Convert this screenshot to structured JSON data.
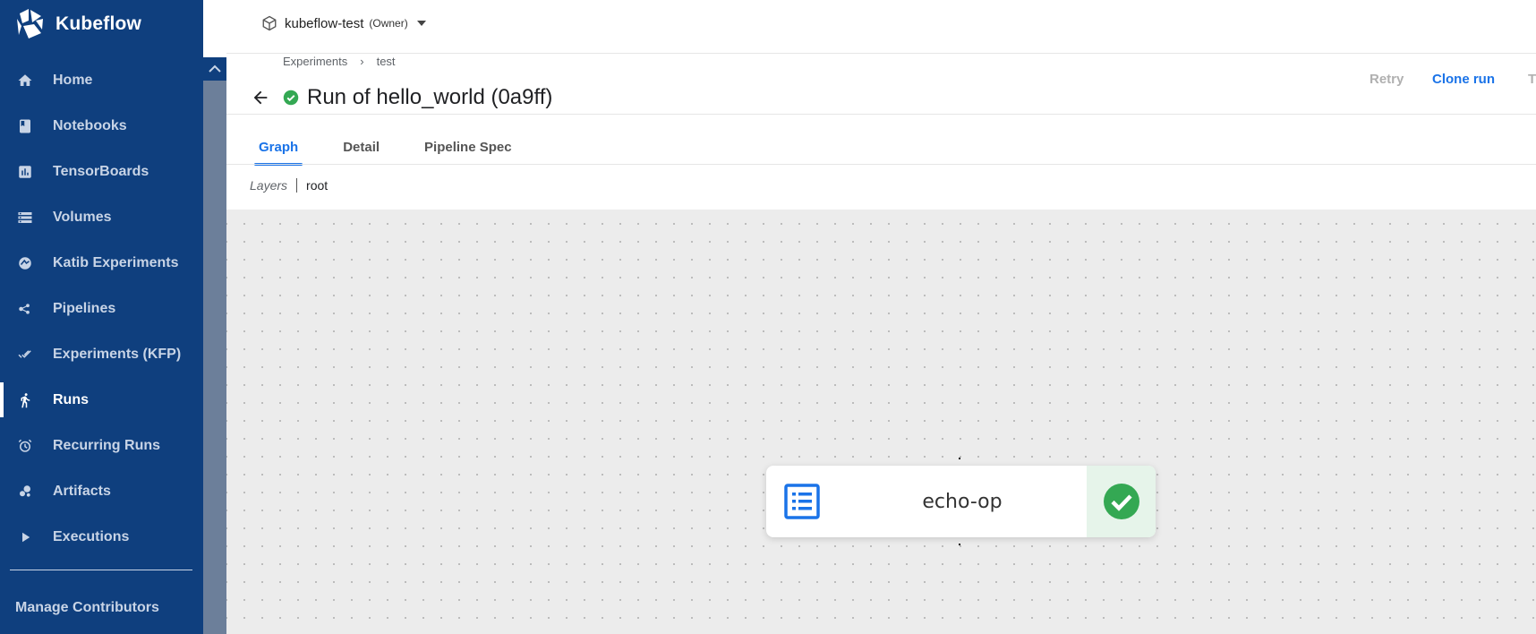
{
  "brand": {
    "name": "Kubeflow"
  },
  "sidebar": {
    "items": [
      {
        "label": "Home",
        "icon": "home-icon"
      },
      {
        "label": "Notebooks",
        "icon": "book-icon"
      },
      {
        "label": "TensorBoards",
        "icon": "bar-chart-icon"
      },
      {
        "label": "Volumes",
        "icon": "storage-icon"
      },
      {
        "label": "Katib Experiments",
        "icon": "katib-icon"
      },
      {
        "label": "Pipelines",
        "icon": "pipeline-icon"
      },
      {
        "label": "Experiments (KFP)",
        "icon": "done-all-icon"
      },
      {
        "label": "Runs",
        "icon": "run-icon",
        "active": true
      },
      {
        "label": "Recurring Runs",
        "icon": "alarm-icon"
      },
      {
        "label": "Artifacts",
        "icon": "bubble-chart-icon"
      },
      {
        "label": "Executions",
        "icon": "play-arrow-icon"
      }
    ],
    "manage_label": "Manage Contributors"
  },
  "topbar": {
    "namespace": "kubeflow-test",
    "role": "(Owner)"
  },
  "breadcrumb": {
    "items": [
      "Experiments",
      "test"
    ],
    "separator": "›"
  },
  "page": {
    "title": "Run of hello_world (0a9ff)",
    "status": "succeeded"
  },
  "actions": {
    "retry": "Retry",
    "clone": "Clone run",
    "truncated": "T"
  },
  "tabs": [
    {
      "label": "Graph",
      "active": true
    },
    {
      "label": "Detail"
    },
    {
      "label": "Pipeline Spec"
    }
  ],
  "layers": {
    "label": "Layers",
    "value": "root"
  },
  "graph": {
    "nodes": [
      {
        "label": "echo-op",
        "status": "succeeded"
      }
    ]
  },
  "colors": {
    "sidebar": "#0f3f7e",
    "accent": "#1a73e8",
    "success": "#34a853",
    "canvas": "#ececec"
  }
}
